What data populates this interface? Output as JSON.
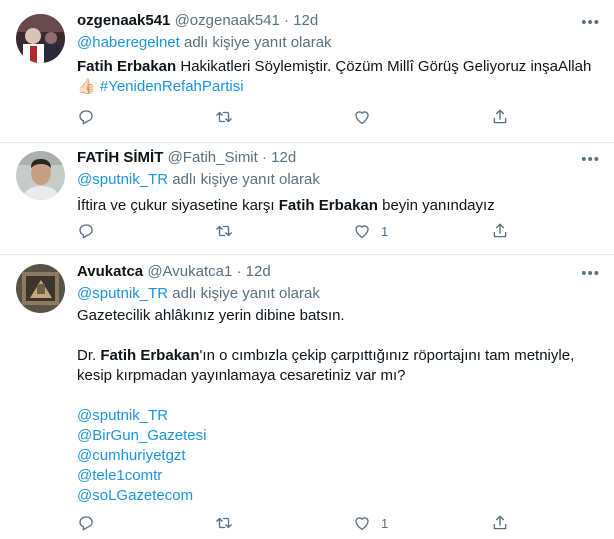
{
  "tweets": [
    {
      "name": "ozgenaak541",
      "handle": "@ozgenaak541",
      "dot": "·",
      "time": "12d",
      "reply_handle": "@haberegelnet",
      "reply_suffix": " adlı kişiye yanıt olarak",
      "lines": [
        {
          "parts": [
            {
              "t": "Fatih Erbakan",
              "s": "b"
            },
            {
              "t": " Hakikatleri Söylemiştir. Çözüm Millî Görüş Geliyoruz inşaAllah",
              "s": ""
            }
          ]
        },
        {
          "parts": [
            {
              "t": "👍🏻 ",
              "s": ""
            },
            {
              "t": "#YenidenRefahPartisi",
              "s": "blue"
            }
          ]
        }
      ],
      "like_count": ""
    },
    {
      "name": "FATİH SİMİT",
      "handle": "@Fatih_Simit",
      "dot": "·",
      "time": "12d",
      "reply_handle": "@sputnik_TR",
      "reply_suffix": " adlı kişiye yanıt olarak",
      "lines": [
        {
          "parts": [
            {
              "t": "İftira ve çukur siyasetine karşı ",
              "s": ""
            },
            {
              "t": "Fatih Erbakan",
              "s": "b"
            },
            {
              "t": " beyin yanındayız",
              "s": ""
            }
          ]
        }
      ],
      "like_count": "1"
    },
    {
      "name": "Avukatca",
      "handle": "@Avukatca1",
      "dot": "·",
      "time": "12d",
      "reply_handle": "@sputnik_TR",
      "reply_suffix": " adlı kişiye yanıt olarak",
      "lines": [
        {
          "parts": [
            {
              "t": "Gazetecilik ahlâkınız yerin dibine batsın.",
              "s": ""
            }
          ]
        },
        {
          "parts": []
        },
        {
          "parts": [
            {
              "t": "Dr. ",
              "s": ""
            },
            {
              "t": "Fatih Erbakan",
              "s": "b"
            },
            {
              "t": "'ın o cımbızla çekip çarpıttığınız röportajını tam metniyle,",
              "s": ""
            }
          ]
        },
        {
          "parts": [
            {
              "t": "kesip kırpmadan yayınlamaya cesaretiniz var mı?",
              "s": ""
            }
          ]
        },
        {
          "parts": []
        },
        {
          "parts": [
            {
              "t": "@sputnik_TR",
              "s": "blue"
            }
          ]
        },
        {
          "parts": [
            {
              "t": "@BirGun_Gazetesi",
              "s": "blue"
            }
          ]
        },
        {
          "parts": [
            {
              "t": "@cumhuriyetgzt",
              "s": "blue"
            }
          ]
        },
        {
          "parts": [
            {
              "t": "@tele1comtr",
              "s": "blue"
            }
          ]
        },
        {
          "parts": [
            {
              "t": "@soLGazetecom",
              "s": "blue"
            }
          ]
        }
      ],
      "like_count": "1"
    }
  ],
  "icons": {
    "reply": "reply-icon",
    "retweet": "retweet-icon",
    "like": "like-icon",
    "share": "share-icon",
    "more": "more-icon"
  },
  "colors": {
    "link": "#1b95e0",
    "muted": "#5b7083",
    "border": "#e6ecf0"
  }
}
